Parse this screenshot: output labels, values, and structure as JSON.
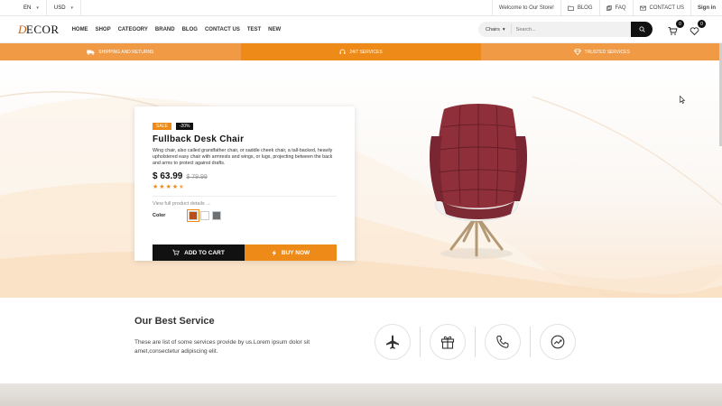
{
  "topbar": {
    "language": "EN",
    "currency": "USD",
    "welcome": "Welcome to Our Store!",
    "blog": "BLOG",
    "faq": "FAQ",
    "contact": "CONTACT US",
    "signin": "Sign in"
  },
  "logo": {
    "text": "ECOR",
    "initial": "D"
  },
  "menu": [
    "HOME",
    "SHOP",
    "CATEGORY",
    "BRAND",
    "BLOG",
    "CONTACT US",
    "TEST",
    "NEW"
  ],
  "search": {
    "category": "Chairs",
    "placeholder": "Search..."
  },
  "cart_count": "0",
  "wishlist_count": "0",
  "strip": {
    "shipping": "SHIPPING AND RETURNS",
    "services": "24/7 SERVICES",
    "trusted": "TRUSTED SERVICES"
  },
  "product": {
    "badge_sale": "SALE",
    "badge_discount": "-20%",
    "title": "Fullback Desk Chair",
    "description": "Wing chair, also called grandfather chair, or saddle cheek chair, a tall-backed, heavily upholstered easy chair with armrests and wings, or lugs, projecting between the back and arms to protect against drafts.",
    "price": "$ 63.99",
    "old_price": "$ 79.99",
    "rating": 4.5,
    "view_link": "View full product details",
    "color_label": "Color",
    "colors": [
      "#b5501c",
      "#ffffff",
      "#6b6f76"
    ],
    "add_to_cart": "ADD TO CART",
    "buy_now": "BUY NOW"
  },
  "service": {
    "title": "Our Best Service",
    "text": "These are list of some services provide by us.Lorem ipsum dolor sit amet,consectetur adipiscing elit.",
    "icons": [
      "plane-icon",
      "gift-icon",
      "phone-icon",
      "trend-icon"
    ]
  },
  "colors": {
    "accent": "#ee8a17",
    "accent_light": "#f09a45",
    "dark": "#111111"
  }
}
